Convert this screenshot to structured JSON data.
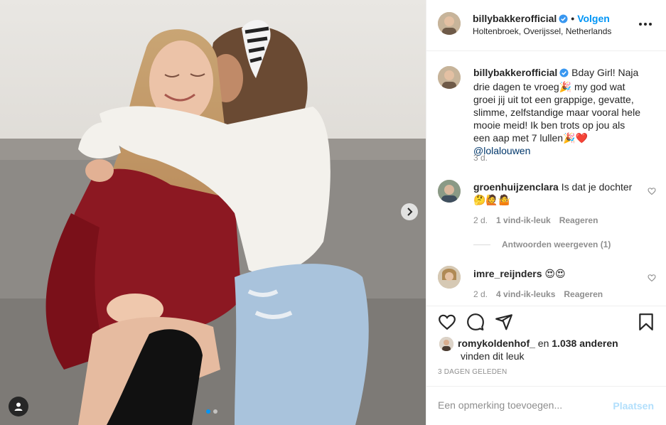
{
  "post": {
    "username": "billybakkerofficial",
    "follow_label": "Volgen",
    "bullet": "•",
    "location": "Holtenbroek, Overijssel, Netherlands"
  },
  "caption": {
    "username": "billybakkerofficial",
    "text": "Bday Girl! Naja drie dagen te vroeg🎉 my god wat groei jij uit tot een grappige, gevatte, slimme, zelfstandige maar vooral hele mooie meid! Ik ben trots op jou als een aap met 7 lullen🎉❤️",
    "mention": "@lolalouwen",
    "time": "3 d."
  },
  "comments": [
    {
      "username": "groenhuijzenclara",
      "text": "Is dat je dochter🤔🙋🤷",
      "time": "2 d.",
      "likes": "1 vind-ik-leuk",
      "reply_label": "Reageren",
      "view_replies": "Antwoorden weergeven (1)"
    },
    {
      "username": "imre_reijnders",
      "text": "😍😍",
      "time": "2 d.",
      "likes": "4 vind-ik-leuks",
      "reply_label": "Reageren"
    }
  ],
  "likes": {
    "user": "romykoldenhof_",
    "and_label": "en",
    "others": "1.038 anderen",
    "suffix": "vinden dit leuk"
  },
  "date_label": "3 DAGEN GELEDEN",
  "add_comment": {
    "placeholder": "Een opmerking toevoegen...",
    "post_label": "Plaatsen"
  },
  "icons": {
    "verified": "verified-badge-icon",
    "more": "more-options-icon",
    "like": "heart-icon",
    "comment": "comment-icon",
    "share": "share-icon",
    "save": "bookmark-icon",
    "next": "chevron-right-icon",
    "tags": "user-tag-icon"
  },
  "colors": {
    "accent": "#0095f6",
    "verified": "#3897f0",
    "muted": "#8e8e8e",
    "post_disabled": "#b2dffc"
  }
}
